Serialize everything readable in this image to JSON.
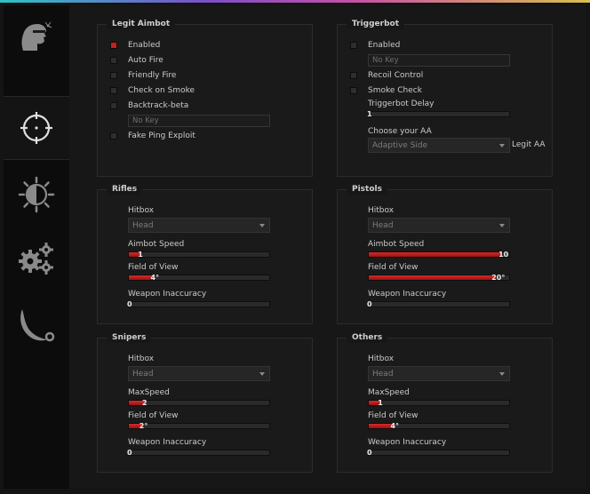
{
  "sidebar": {
    "tabs": [
      {
        "name": "rage-tab",
        "icon": "headshot-icon"
      },
      {
        "name": "legit-tab",
        "icon": "crosshair-icon"
      },
      {
        "name": "visuals-tab",
        "icon": "brightness-icon"
      },
      {
        "name": "settings-tab",
        "icon": "gears-icon"
      },
      {
        "name": "skins-tab",
        "icon": "karambit-knife-icon"
      }
    ],
    "active": 1
  },
  "legit_aimbot": {
    "title": "Legit Aimbot",
    "enabled": "Enabled",
    "auto_fire": "Auto Fire",
    "friendly_fire": "Friendly Fire",
    "check_on_smoke": "Check on Smoke",
    "backtrack": "Backtrack-beta",
    "key_placeholder": "No Key",
    "fake_ping": "Fake Ping Exploit"
  },
  "triggerbot": {
    "title": "Triggerbot",
    "enabled": "Enabled",
    "key_placeholder": "No Key",
    "recoil_control": "Recoil Control",
    "smoke_check": "Smoke Check",
    "delay_label": "Triggerbot Delay",
    "delay_value": "1",
    "aa_label": "Choose your AA",
    "aa_value": "Adaptive Side",
    "legit_aa": "Legit AA"
  },
  "rifles": {
    "title": "Rifles",
    "hitbox_label": "Hitbox",
    "hitbox_value": "Head",
    "speed_label": "Aimbot Speed",
    "speed_value": "1",
    "speed_fraction": 0.09,
    "fov_label": "Field of View",
    "fov_value": "4°",
    "fov_fraction": 0.18,
    "inacc_label": "Weapon Inaccuracy",
    "inacc_value": "0",
    "inacc_fraction": 0
  },
  "pistols": {
    "title": "Pistols",
    "hitbox_label": "Hitbox",
    "hitbox_value": "Head",
    "speed_label": "Aimbot Speed",
    "speed_value": "10",
    "speed_fraction": 0.95,
    "fov_label": "Field of View",
    "fov_value": "20°",
    "fov_fraction": 0.9,
    "inacc_label": "Weapon Inaccuracy",
    "inacc_value": "0",
    "inacc_fraction": 0
  },
  "snipers": {
    "title": "Snipers",
    "hitbox_label": "Hitbox",
    "hitbox_value": "Head",
    "speed_label": "MaxSpeed",
    "speed_value": "2",
    "speed_fraction": 0.12,
    "fov_label": "Field of View",
    "fov_value": "2°",
    "fov_fraction": 0.1,
    "inacc_label": "Weapon Inaccuracy",
    "inacc_value": "0",
    "inacc_fraction": 0
  },
  "others": {
    "title": "Others",
    "hitbox_label": "Hitbox",
    "hitbox_value": "Head",
    "speed_label": "MaxSpeed",
    "speed_value": "1",
    "speed_fraction": 0.09,
    "fov_label": "Field of View",
    "fov_value": "4°",
    "fov_fraction": 0.18,
    "inacc_label": "Weapon Inaccuracy",
    "inacc_value": "0",
    "inacc_fraction": 0
  },
  "colors": {
    "accent": "#c81e1e",
    "background": "#171717",
    "sidebar": "#0c0c0c"
  }
}
